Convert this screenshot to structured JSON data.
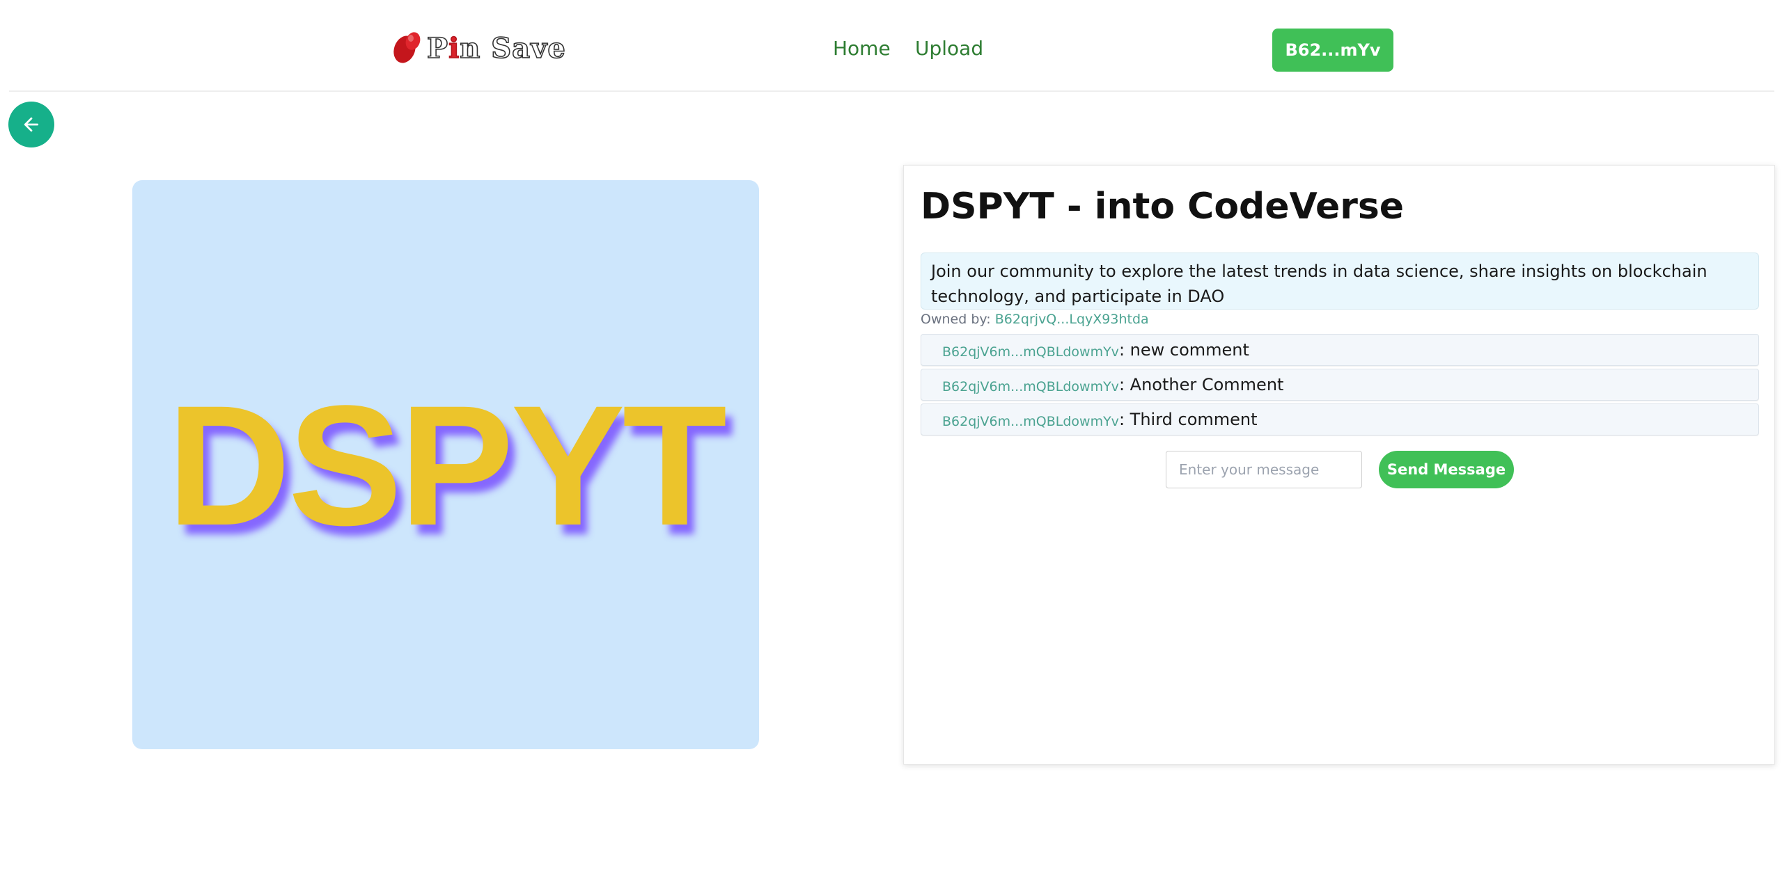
{
  "header": {
    "logo_text_p": "P",
    "logo_text_i": "i",
    "logo_text_rest": "n Save",
    "nav": [
      {
        "label": "Home"
      },
      {
        "label": "Upload"
      }
    ],
    "wallet_label": "B62...mYv"
  },
  "back_button": {
    "icon": "arrow-left-icon"
  },
  "image": {
    "text": "DSPYT"
  },
  "detail": {
    "title": "DSPYT - into CodeVerse",
    "description": "Join our community to explore the latest trends in data science, share insights on blockchain technology, and participate in DAO",
    "owned_by_label": "Owned by:",
    "owner": "B62qrjvQ...LqyX93htda",
    "comments": [
      {
        "author": "B62qjV6m...mQBLdowmYv",
        "text": ": new comment"
      },
      {
        "author": "B62qjV6m...mQBLdowmYv",
        "text": ": Another Comment"
      },
      {
        "author": "B62qjV6m...mQBLdowmYv",
        "text": ": Third comment"
      }
    ],
    "message_placeholder": "Enter your message",
    "send_label": "Send Message"
  },
  "colors": {
    "accent_green": "#40c057",
    "nav_green": "#2e7d32",
    "back_button_teal": "#16b08a",
    "image_background": "#cde6fc",
    "image_text": "#ecc42b"
  }
}
